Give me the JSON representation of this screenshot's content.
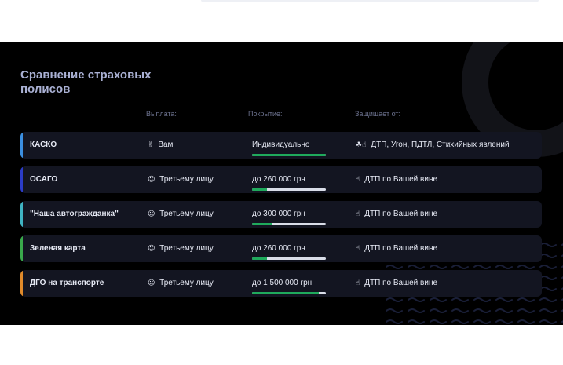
{
  "section": {
    "title": "Сравнение страховых полисов",
    "columns": {
      "payout": "Выплата:",
      "coverage": "Покрытие:",
      "protects": "Защищает от:"
    }
  },
  "rows": [
    {
      "name": "КАСКО",
      "payout_icon": "✌",
      "payout": "Вам",
      "coverage": "Индивидуально",
      "coverage_level": 1.0,
      "protects_icon": "☘☝",
      "protects": "ДТП, Угон, ПДТЛ, Стихийных явлений",
      "accent": "#3b8fe0"
    },
    {
      "name": "ОСАГО",
      "payout_icon": "☺",
      "payout": "Третьему лицу",
      "coverage": "до 260 000 грн",
      "coverage_level": 0.2,
      "protects_icon": "☝",
      "protects": "ДТП по Вашей вине",
      "accent": "#2b3cc8"
    },
    {
      "name": "\"Наша автогражданка\"",
      "payout_icon": "☺",
      "payout": "Третьему лицу",
      "coverage": "до 300 000 грн",
      "coverage_level": 0.28,
      "protects_icon": "☝",
      "protects": "ДТП по Вашей вине",
      "accent": "#3fb3c2"
    },
    {
      "name": "Зеленая карта",
      "payout_icon": "☺",
      "payout": "Третьему лицу",
      "coverage": "до 260 000 грн",
      "coverage_level": 0.2,
      "protects_icon": "☝",
      "protects": "ДТП по Вашей вине",
      "accent": "#39a84b"
    },
    {
      "name": "ДГО на транспорте",
      "payout_icon": "☺",
      "payout": "Третьему лицу",
      "coverage": "до 1 500 000 грн",
      "coverage_level": 0.9,
      "protects_icon": "☝",
      "protects": "ДТП по Вашей вине",
      "accent": "#e08a2a"
    }
  ],
  "colors": {
    "background": "#000000",
    "row_background": "#131521",
    "title": "#aab1d4",
    "bar_fill": "#1faa5c",
    "bar_track": "#d9dde8"
  }
}
